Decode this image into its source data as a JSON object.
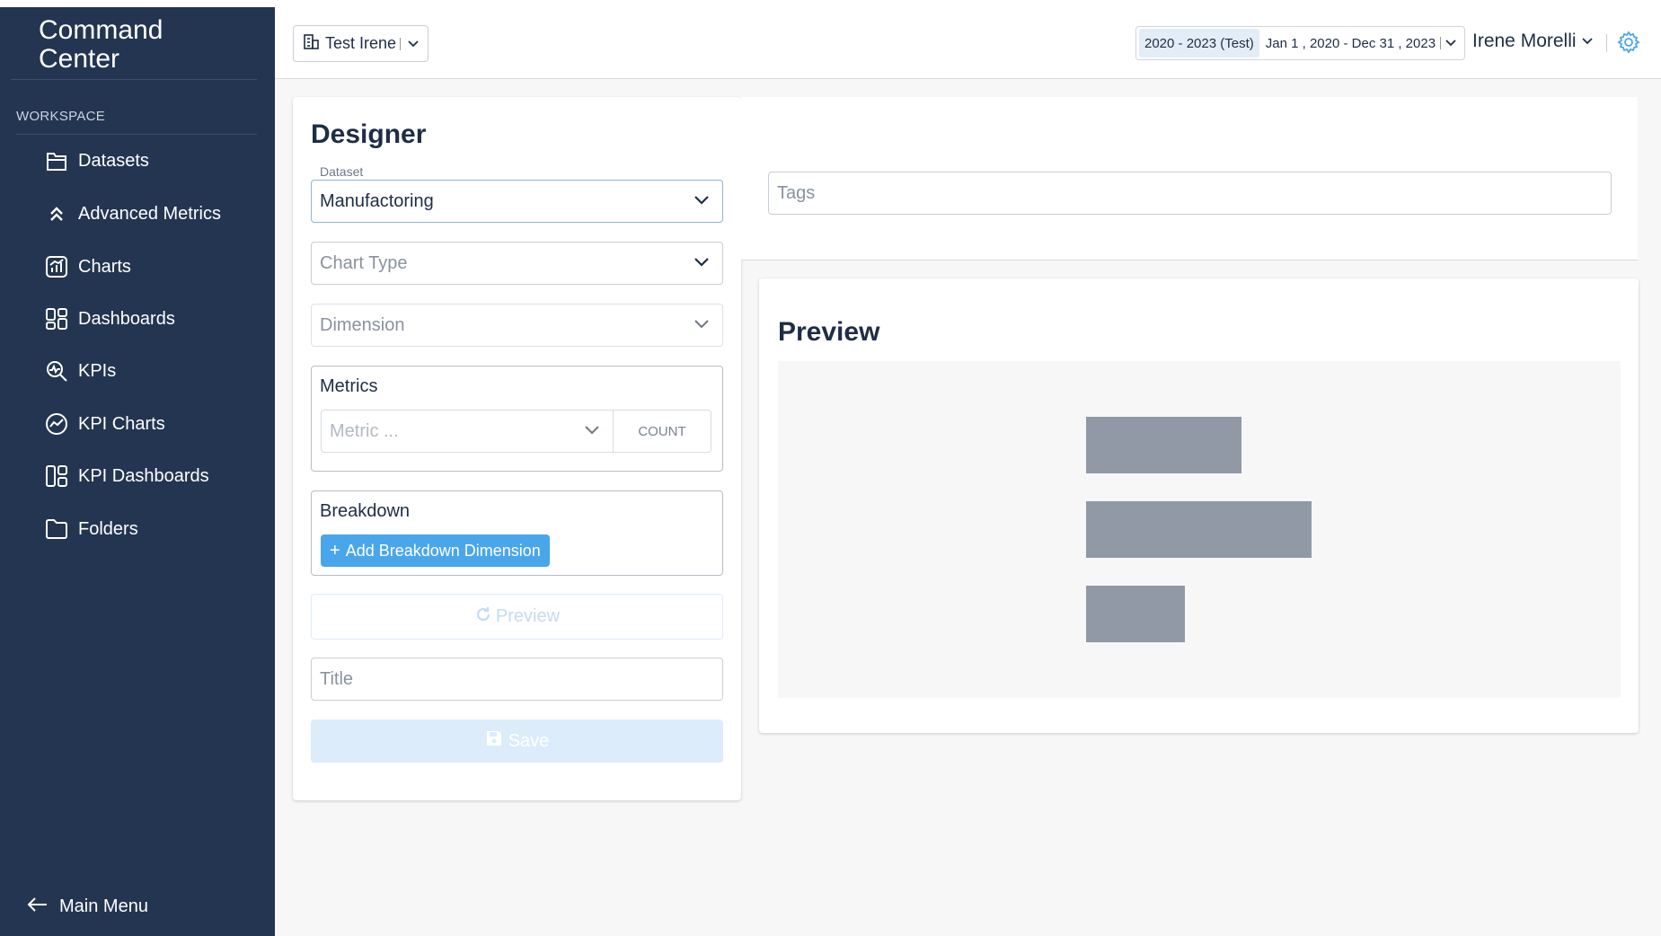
{
  "sidebar": {
    "brand": "Command Center",
    "workspace_label": "WORKSPACE",
    "items": [
      {
        "label": "Datasets",
        "icon": "datasets-icon"
      },
      {
        "label": "Advanced Metrics",
        "icon": "advanced-metrics-icon"
      },
      {
        "label": "Charts",
        "icon": "charts-icon"
      },
      {
        "label": "Dashboards",
        "icon": "dashboards-icon"
      },
      {
        "label": "KPIs",
        "icon": "kpis-icon"
      },
      {
        "label": "KPI Charts",
        "icon": "kpi-charts-icon"
      },
      {
        "label": "KPI Dashboards",
        "icon": "kpi-dashboards-icon"
      },
      {
        "label": "Folders",
        "icon": "folder-icon"
      }
    ],
    "main_menu": "Main Menu"
  },
  "header": {
    "org": "Test Irene",
    "date_badge": "2020 - 2023 (Test)",
    "date_range": "Jan 1 , 2020 - Dec 31 , 2023",
    "user": "Irene Morelli"
  },
  "designer": {
    "title": "Designer",
    "dataset_label": "Dataset",
    "dataset_value": "Manufactoring",
    "chart_type_placeholder": "Chart Type",
    "dimension_placeholder": "Dimension",
    "metrics_label": "Metrics",
    "metric_placeholder": "Metric ...",
    "count_label": "COUNT",
    "breakdown_label": "Breakdown",
    "add_breakdown": "Add Breakdown Dimension",
    "preview_button": "Preview",
    "title_placeholder": "Title",
    "save_button": "Save"
  },
  "tags": {
    "placeholder": "Tags"
  },
  "preview": {
    "title": "Preview"
  },
  "colors": {
    "sidebar_bg": "#243551",
    "accent": "#4aa6ea",
    "placeholder_bar": "#9199a6"
  }
}
